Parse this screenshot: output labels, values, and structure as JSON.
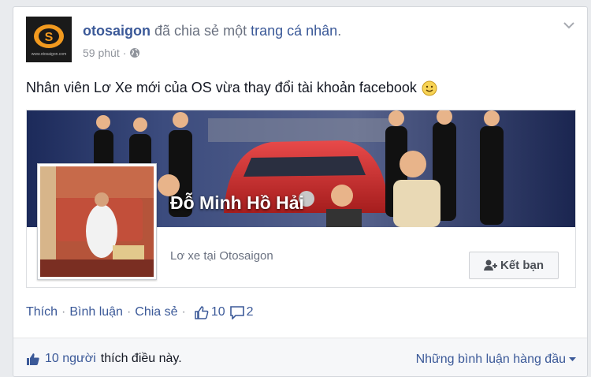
{
  "post": {
    "author": "otosaigon",
    "action_text": "đã chia sẻ một",
    "shared_link": "trang cá nhân",
    "period": ".",
    "timestamp": "59 phút",
    "meta_sep": "·",
    "message": "Nhân viên Lơ Xe mới của OS vừa thay đổi tài khoản facebook",
    "avatar_logo_text": "www.otosaigon.com",
    "icons": {
      "options": "chevron-down-icon",
      "privacy": "globe-icon",
      "emoji": "smiley-icon"
    }
  },
  "shared_profile": {
    "name": "Đỗ Minh Hồ Hải",
    "work": "Lơ xe tại Otosaigon",
    "add_friend_label": "Kết bạn",
    "add_friend_icon": "add-friend-icon"
  },
  "actions": {
    "like": "Thích",
    "comment": "Bình luận",
    "share": "Chia sẻ",
    "sep": "·",
    "like_count": "10",
    "comment_count": "2"
  },
  "summary": {
    "likes_count_text": "10 người",
    "likes_suffix": "thích điều này.",
    "sort_label": "Những bình luận hàng đầu"
  },
  "colors": {
    "link": "#3b5998",
    "muted": "#90949c",
    "text": "#141823"
  }
}
